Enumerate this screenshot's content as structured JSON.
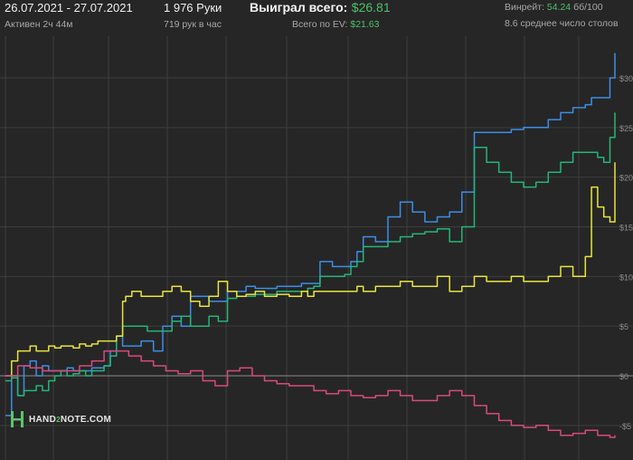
{
  "header": {
    "date_range": "26.07.2021 - 27.07.2021",
    "active_time": "Активен 2ч 44м",
    "hands": "1 976 Руки",
    "hands_per_hour": "719 рук в час",
    "won_total_label": "Выиграл всего:",
    "won_total_value": "$26.81",
    "ev_total_label": "Всего по EV:",
    "ev_total_value": "$21.63",
    "winrate_label": "Винрейт:",
    "winrate_value": "54.24",
    "winrate_unit": "бб/100",
    "avg_tables": "8.6 среднее число столов"
  },
  "footer": {
    "logo_text_a": "HAND",
    "logo_text_b": "2",
    "logo_text_c": "NOTE.COM"
  },
  "colors": {
    "background": "#262626",
    "grid": "#3e3e3e",
    "zero_line": "#8c8c8c",
    "blue": "#3c8ee8",
    "green": "#24b57a",
    "yellow": "#e8e43c",
    "pink": "#d94a7c",
    "accent_green": "#4cc06a"
  },
  "chart_data": {
    "type": "line",
    "x_unit": "hands",
    "xlim": [
      0,
      1976
    ],
    "ylim": [
      -7,
      33
    ],
    "yticks": [
      -5,
      0,
      5,
      10,
      15,
      20,
      25,
      30
    ],
    "ytick_labels": [
      "-$5",
      "$0",
      "$5",
      "$10",
      "$15",
      "$20",
      "$25",
      "$30"
    ],
    "grid": true,
    "legend": "none",
    "series": [
      {
        "color": "blue",
        "x": [
          0,
          20,
          40,
          60,
          80,
          100,
          120,
          140,
          160,
          180,
          200,
          220,
          240,
          260,
          280,
          300,
          320,
          340,
          360,
          380,
          390,
          410,
          440,
          460,
          480,
          510,
          540,
          570,
          600,
          630,
          660,
          690,
          720,
          750,
          780,
          810,
          840,
          880,
          920,
          960,
          980,
          1000,
          1020,
          1060,
          1100,
          1120,
          1140,
          1160,
          1200,
          1240,
          1280,
          1320,
          1360,
          1400,
          1440,
          1480,
          1520,
          1560,
          1600,
          1640,
          1680,
          1720,
          1760,
          1800,
          1840,
          1880,
          1900,
          1920,
          1940,
          1960,
          1976
        ],
        "y": [
          -4.0,
          0.0,
          -2.0,
          1.0,
          1.5,
          0.0,
          1.0,
          0.5,
          0.5,
          0.5,
          0.8,
          0.5,
          0.5,
          0.5,
          0.8,
          0.8,
          1.0,
          2.5,
          4.0,
          3.0,
          3.0,
          3.0,
          3.5,
          3.5,
          2.5,
          5.0,
          6.0,
          5.0,
          8.0,
          8.0,
          7.5,
          7.5,
          8.5,
          8.5,
          9.0,
          8.8,
          8.8,
          9.0,
          9.0,
          9.3,
          9.3,
          9.3,
          11.5,
          11.0,
          11.0,
          11.5,
          12.5,
          14.0,
          13.5,
          16.0,
          17.5,
          16.5,
          15.5,
          16.0,
          16.5,
          18.5,
          24.5,
          24.5,
          24.5,
          24.8,
          25.0,
          25.0,
          25.8,
          26.5,
          27.0,
          27.3,
          28.0,
          28.0,
          28.0,
          30.0,
          32.5
        ]
      },
      {
        "color": "green",
        "x": [
          0,
          20,
          40,
          60,
          80,
          100,
          120,
          140,
          160,
          180,
          200,
          220,
          240,
          260,
          280,
          300,
          320,
          340,
          360,
          380,
          390,
          410,
          440,
          460,
          480,
          510,
          540,
          570,
          600,
          630,
          660,
          690,
          720,
          750,
          780,
          810,
          840,
          880,
          920,
          960,
          980,
          1000,
          1020,
          1060,
          1100,
          1120,
          1140,
          1160,
          1200,
          1240,
          1280,
          1320,
          1360,
          1400,
          1440,
          1480,
          1520,
          1560,
          1600,
          1640,
          1680,
          1720,
          1760,
          1800,
          1840,
          1880,
          1900,
          1920,
          1940,
          1960,
          1976
        ],
        "y": [
          -0.5,
          -0.2,
          -2.0,
          -1.5,
          -1.5,
          -1.0,
          -1.5,
          -0.5,
          0.0,
          0.5,
          0.0,
          0.2,
          0.5,
          0.0,
          0.5,
          0.5,
          1.0,
          2.0,
          4.0,
          5.0,
          5.0,
          5.0,
          5.0,
          4.5,
          4.5,
          4.5,
          5.5,
          6.0,
          5.0,
          5.0,
          6.0,
          5.5,
          7.8,
          8.0,
          8.0,
          8.2,
          8.2,
          8.5,
          8.5,
          8.5,
          8.8,
          9.0,
          10.0,
          10.0,
          10.2,
          11.0,
          11.5,
          13.0,
          13.0,
          13.5,
          14.0,
          14.3,
          14.5,
          14.8,
          13.5,
          15.0,
          23.0,
          21.5,
          20.5,
          19.5,
          19.0,
          19.5,
          20.5,
          21.5,
          22.5,
          22.5,
          22.5,
          22.0,
          21.5,
          24.0,
          26.5
        ]
      },
      {
        "color": "yellow",
        "x": [
          0,
          20,
          40,
          60,
          80,
          100,
          120,
          140,
          160,
          180,
          200,
          220,
          240,
          260,
          280,
          300,
          320,
          340,
          360,
          380,
          390,
          410,
          440,
          460,
          480,
          510,
          540,
          570,
          600,
          630,
          660,
          690,
          720,
          750,
          780,
          810,
          840,
          880,
          920,
          960,
          980,
          1000,
          1020,
          1060,
          1100,
          1120,
          1140,
          1160,
          1200,
          1240,
          1280,
          1320,
          1360,
          1400,
          1440,
          1480,
          1520,
          1560,
          1600,
          1640,
          1680,
          1720,
          1760,
          1800,
          1840,
          1880,
          1900,
          1920,
          1940,
          1960,
          1976
        ],
        "y": [
          0.0,
          1.5,
          2.5,
          2.5,
          3.0,
          2.5,
          2.5,
          3.0,
          2.8,
          3.0,
          3.0,
          2.8,
          3.2,
          3.0,
          3.2,
          3.5,
          3.5,
          3.5,
          4.0,
          7.5,
          8.0,
          8.5,
          8.0,
          8.0,
          8.0,
          8.5,
          9.0,
          8.5,
          7.5,
          7.0,
          8.0,
          9.5,
          8.5,
          8.0,
          8.2,
          8.5,
          8.0,
          8.2,
          8.0,
          8.5,
          8.0,
          8.5,
          8.5,
          8.5,
          8.5,
          8.5,
          9.0,
          8.5,
          9.0,
          9.0,
          9.5,
          9.0,
          9.0,
          10.0,
          8.5,
          9.0,
          10.0,
          9.5,
          9.5,
          10.0,
          9.5,
          9.5,
          10.0,
          11.0,
          10.0,
          12.0,
          19.0,
          17.0,
          16.0,
          15.5,
          21.5
        ]
      },
      {
        "color": "pink",
        "x": [
          0,
          40,
          80,
          120,
          160,
          200,
          240,
          280,
          320,
          360,
          400,
          440,
          480,
          520,
          560,
          600,
          640,
          680,
          720,
          760,
          800,
          840,
          880,
          920,
          960,
          1000,
          1040,
          1080,
          1120,
          1160,
          1200,
          1240,
          1280,
          1320,
          1360,
          1400,
          1440,
          1480,
          1520,
          1560,
          1600,
          1640,
          1680,
          1720,
          1760,
          1800,
          1840,
          1880,
          1920,
          1960,
          1976
        ],
        "y": [
          0.0,
          1.0,
          0.8,
          0.5,
          0.5,
          0.5,
          1.0,
          1.5,
          2.5,
          2.5,
          2.0,
          1.5,
          1.0,
          0.5,
          0.2,
          0.5,
          -0.5,
          -1.0,
          0.5,
          0.8,
          0.0,
          -0.5,
          -0.8,
          -1.0,
          -1.0,
          -1.5,
          -1.8,
          -1.5,
          -2.0,
          -2.2,
          -2.0,
          -1.5,
          -2.0,
          -2.5,
          -2.5,
          -2.0,
          -1.5,
          -2.0,
          -3.0,
          -3.8,
          -4.5,
          -5.0,
          -5.2,
          -5.0,
          -5.5,
          -6.0,
          -5.8,
          -5.5,
          -6.0,
          -6.2,
          -6.0
        ]
      }
    ]
  }
}
